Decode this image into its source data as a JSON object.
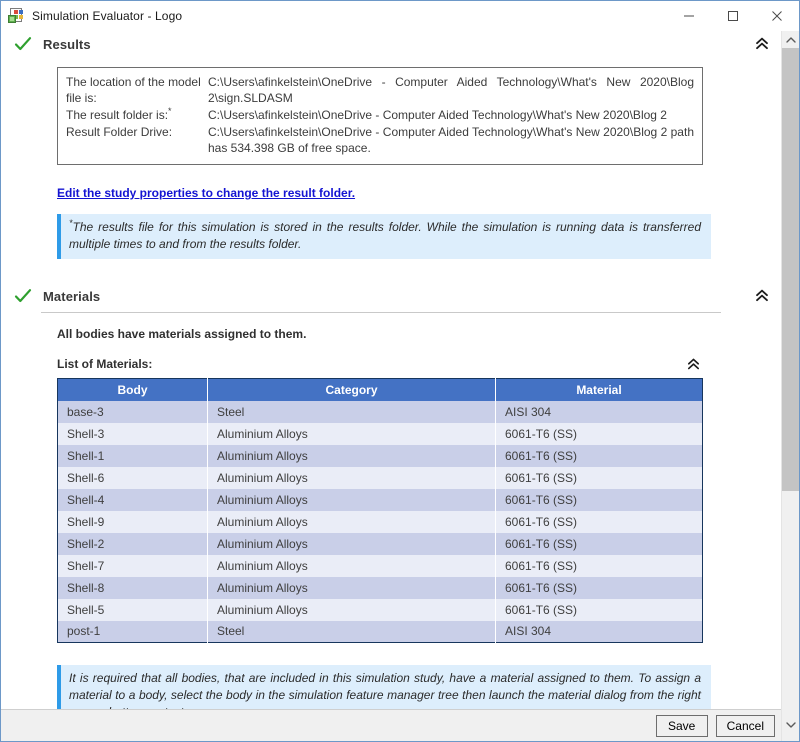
{
  "window": {
    "title": "Simulation Evaluator - Logo",
    "app_icon": "simulation-evaluator-icon",
    "minimize_label": "Minimize",
    "maximize_label": "Maximize",
    "close_label": "Close"
  },
  "results_section": {
    "status_icon": "green-check-icon",
    "title": "Results",
    "collapse_icon": "double-chevron-up-icon",
    "info_rows": [
      {
        "label": "The location of the model file is:",
        "value": "C:\\Users\\afinkelstein\\OneDrive - Computer Aided Technology\\What's New 2020\\Blog 2\\sign.SLDASM",
        "has_footnote": false
      },
      {
        "label": "The result folder is:",
        "value": "C:\\Users\\afinkelstein\\OneDrive - Computer Aided Technology\\What's New 2020\\Blog 2",
        "has_footnote": true
      },
      {
        "label": "Result Folder Drive:",
        "value": "C:\\Users\\afinkelstein\\OneDrive - Computer Aided Technology\\What's New 2020\\Blog 2 path has 534.398 GB of free space.",
        "has_footnote": false
      }
    ],
    "edit_link": "Edit the study properties to change the result folder.",
    "note": "The results file for this simulation is stored in the results folder. While the simulation is running data is transferred multiple times to and from the results folder."
  },
  "materials_section": {
    "status_icon": "green-check-icon",
    "title": "Materials",
    "collapse_icon": "double-chevron-up-icon",
    "summary": "All bodies have materials assigned to them.",
    "list_label": "List of Materials:",
    "list_collapse_icon": "double-chevron-up-icon",
    "table": {
      "headers": [
        "Body",
        "Category",
        "Material"
      ],
      "rows": [
        [
          "base-3",
          "Steel",
          "AISI 304"
        ],
        [
          "Shell-3",
          "Aluminium Alloys",
          "6061-T6 (SS)"
        ],
        [
          "Shell-1",
          "Aluminium Alloys",
          "6061-T6 (SS)"
        ],
        [
          "Shell-6",
          "Aluminium Alloys",
          "6061-T6 (SS)"
        ],
        [
          "Shell-4",
          "Aluminium Alloys",
          "6061-T6 (SS)"
        ],
        [
          "Shell-9",
          "Aluminium Alloys",
          "6061-T6 (SS)"
        ],
        [
          "Shell-2",
          "Aluminium Alloys",
          "6061-T6 (SS)"
        ],
        [
          "Shell-7",
          "Aluminium Alloys",
          "6061-T6 (SS)"
        ],
        [
          "Shell-8",
          "Aluminium Alloys",
          "6061-T6 (SS)"
        ],
        [
          "Shell-5",
          "Aluminium Alloys",
          "6061-T6 (SS)"
        ],
        [
          "post-1",
          "Steel",
          "AISI 304"
        ]
      ]
    },
    "note": "It is required that all bodies, that are included in this simulation study, have a material assigned to them. To assign a material to a body, select the body in the simulation feature manager tree then launch the material dialog from the right mouse button context menu."
  },
  "footer": {
    "save_label": "Save",
    "cancel_label": "Cancel"
  },
  "scrollbar": {
    "up_icon": "chevron-up-icon",
    "down_icon": "chevron-down-icon"
  },
  "colors": {
    "table_header": "#4472C4",
    "table_row_odd": "#C9CFE8",
    "table_row_even": "#EAEDF7",
    "note_background": "#DDEEFC",
    "note_accent": "#2E9BE8",
    "link": "#1414D2",
    "check": "#2FA02F",
    "window_border": "#6D98C8"
  }
}
